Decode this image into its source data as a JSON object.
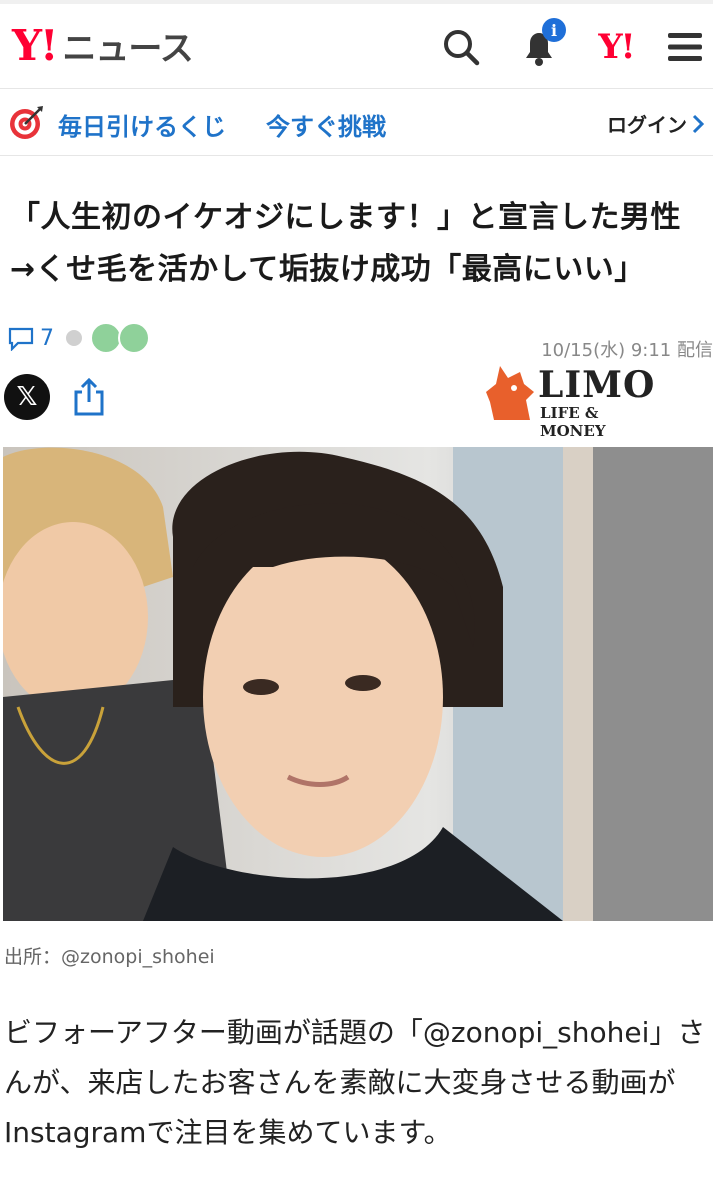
{
  "header": {
    "logo_mark": "Y!",
    "logo_text": "ニュース",
    "notification_badge": "i",
    "yj_logo": "Y!"
  },
  "lottery": {
    "text": "毎日引けるくじ",
    "cta": "今すぐ挑戦",
    "login_label": "ログイン"
  },
  "article": {
    "title": "「人生初のイケオジにします！」と宣言した男性→くせ毛を活かして垢抜け成功「最高にいい」",
    "comment_count": "7",
    "date": "10/15(水) 9:11 配信",
    "source_name": "LIMO",
    "source_tagline": "LIFE & MONEY",
    "photo_caption": "出所：@zonopi_shohei",
    "body": "ビフォーアフター動画が話題の「@zonopi_shohei」さんが、来店したお客さんを素敵に大変身させる動画がInstagramで注目を集めています。"
  },
  "share": {
    "x_label": "𝕏"
  },
  "colors": {
    "brand_red": "#ff0033",
    "link_blue": "#1f73c9",
    "badge_blue": "#1f6fd8"
  }
}
